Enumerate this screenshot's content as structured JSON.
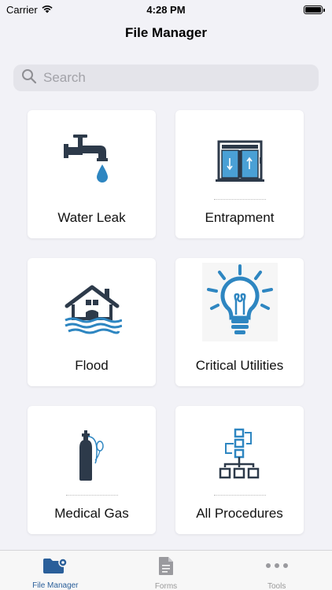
{
  "status_bar": {
    "carrier": "Carrier",
    "time": "4:28 PM"
  },
  "nav": {
    "title": "File Manager"
  },
  "search": {
    "placeholder": "Search",
    "value": ""
  },
  "tiles": [
    {
      "label": "Water Leak",
      "icon": "faucet-icon"
    },
    {
      "label": "Entrapment",
      "icon": "elevator-icon"
    },
    {
      "label": "Flood",
      "icon": "flooded-house-icon"
    },
    {
      "label": "Critical Utilities",
      "icon": "lightbulb-icon"
    },
    {
      "label": "Medical Gas",
      "icon": "gas-cylinder-icon"
    },
    {
      "label": "All Procedures",
      "icon": "flowchart-icon"
    }
  ],
  "tab_bar": {
    "items": [
      {
        "label": "File Manager",
        "icon": "folder-gear-icon",
        "active": true
      },
      {
        "label": "Forms",
        "icon": "document-icon",
        "active": false
      },
      {
        "label": "Tools",
        "icon": "more-dots-icon",
        "active": false
      }
    ]
  },
  "colors": {
    "icon_dark": "#2d3a4a",
    "icon_blue": "#2e86c1",
    "accent": "#2a5f9a",
    "background": "#f2f2f7"
  }
}
